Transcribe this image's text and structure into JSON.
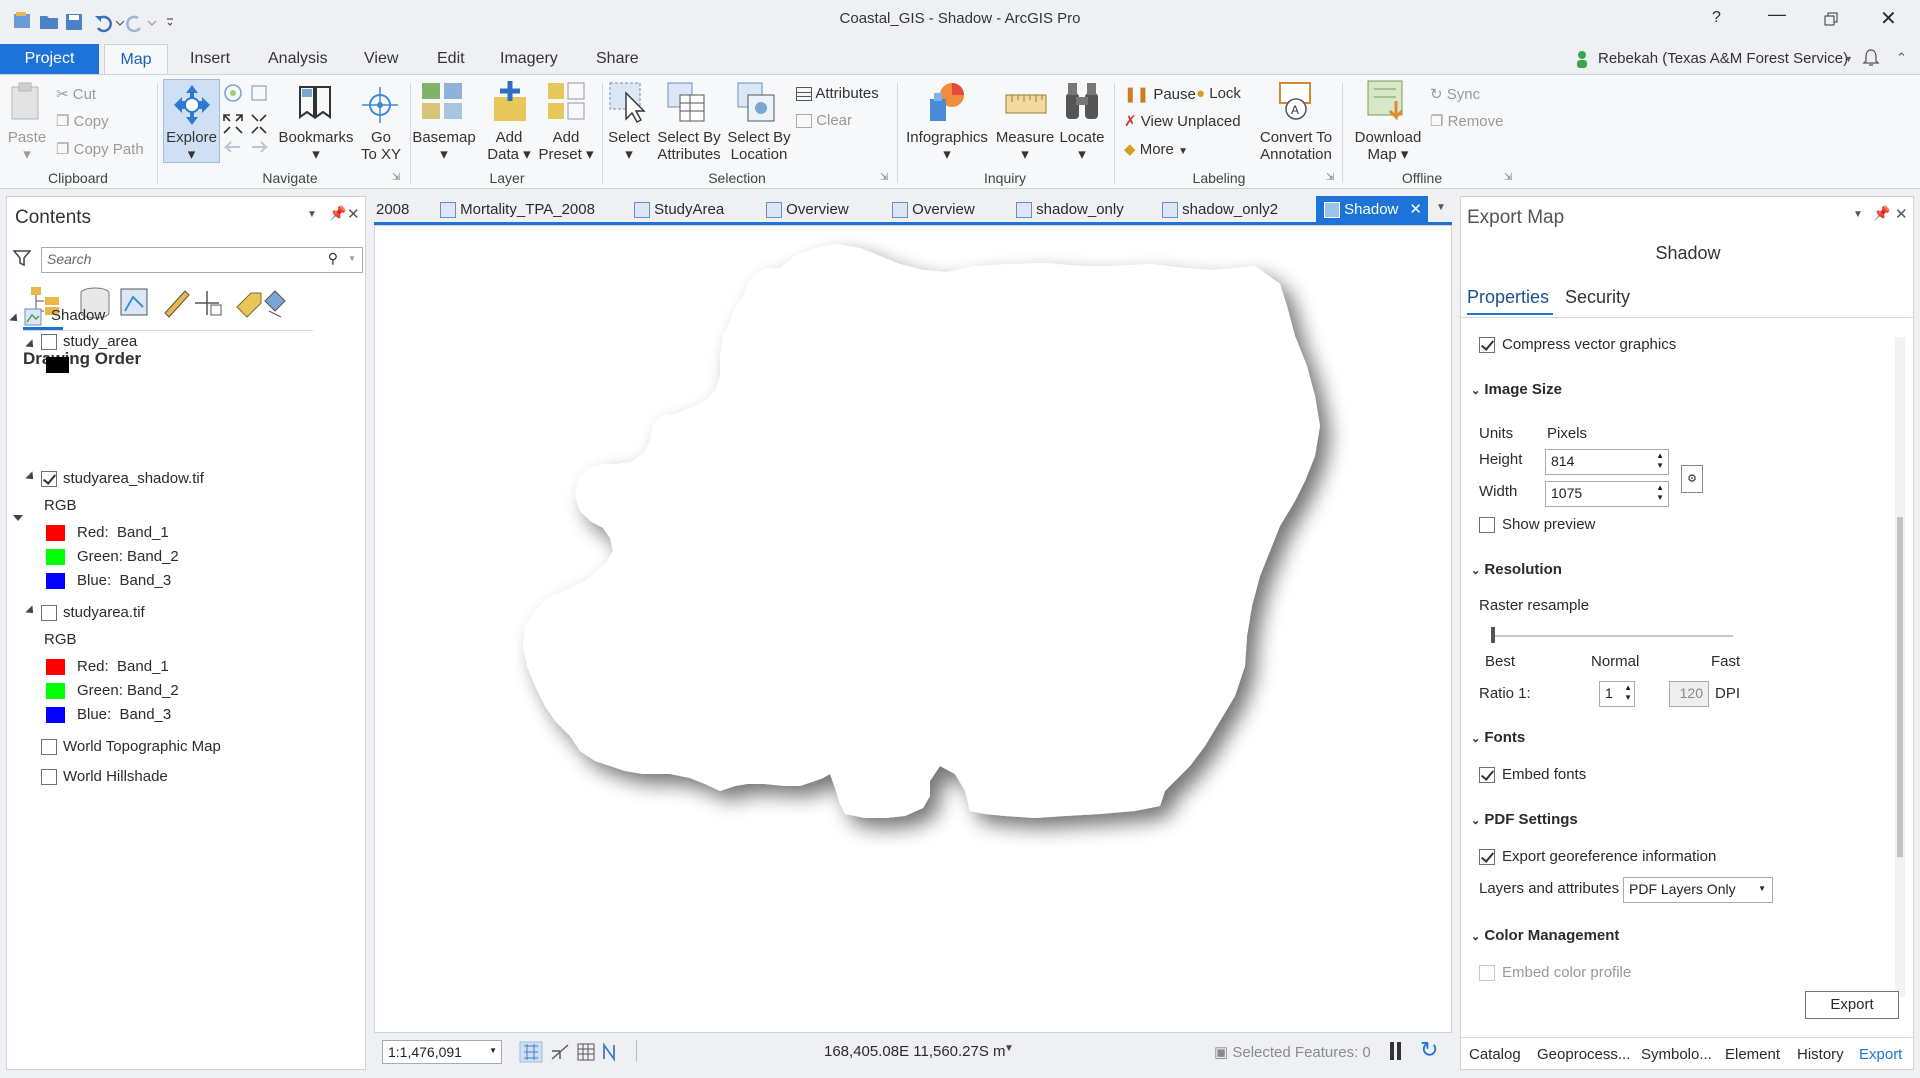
{
  "window": {
    "title": "Coastal_GIS - Shadow - ArcGIS Pro",
    "help": "?",
    "user": "Rebekah (Texas A&M Forest Service)"
  },
  "ribbon_tabs": [
    "Project",
    "Map",
    "Insert",
    "Analysis",
    "View",
    "Edit",
    "Imagery",
    "Share"
  ],
  "clipboard": {
    "paste": "Paste",
    "cut": "Cut",
    "copy": "Copy",
    "copy_path": "Copy Path",
    "label": "Clipboard"
  },
  "navigate": {
    "explore": "Explore",
    "bookmarks": "Bookmarks",
    "goto_1": "Go",
    "goto_2": "To XY",
    "label": "Navigate"
  },
  "layer": {
    "basemap": "Basemap",
    "add_data_1": "Add",
    "add_data_2": "Data",
    "add_preset_1": "Add",
    "add_preset_2": "Preset",
    "label": "Layer"
  },
  "selection": {
    "select": "Select",
    "by_attr_1": "Select By",
    "by_attr_2": "Attributes",
    "by_loc_1": "Select By",
    "by_loc_2": "Location",
    "attributes": "Attributes",
    "clear": "Clear",
    "label": "Selection"
  },
  "inquiry": {
    "infographics": "Infographics",
    "measure": "Measure",
    "locate": "Locate",
    "label": "Inquiry"
  },
  "labeling": {
    "pause": "Pause",
    "lock": "Lock",
    "view_unplaced": "View Unplaced",
    "more": "More",
    "convert_1": "Convert To",
    "convert_2": "Annotation",
    "label": "Labeling"
  },
  "offline": {
    "download_1": "Download",
    "download_2": "Map",
    "sync": "Sync",
    "remove": "Remove",
    "label": "Offline"
  },
  "contents": {
    "title": "Contents",
    "search_placeholder": "Search",
    "drawing_order": "Drawing Order",
    "map_name": "Shadow",
    "layers": [
      {
        "name": "study_area",
        "checked": false
      },
      {
        "name": "studyarea_shadow.tif",
        "checked": true,
        "rgb": "RGB",
        "bands": [
          "Red:  Band_1",
          "Green: Band_2",
          "Blue:  Band_3"
        ]
      },
      {
        "name": "studyarea.tif",
        "checked": false,
        "rgb": "RGB",
        "bands": [
          "Red:  Band_1",
          "Green: Band_2",
          "Blue:  Band_3"
        ]
      },
      {
        "name": "World Topographic Map",
        "checked": false
      },
      {
        "name": "World Hillshade",
        "checked": false
      }
    ]
  },
  "map_tabs": [
    "2008",
    "Mortality_TPA_2008",
    "StudyArea",
    "Overview",
    "Overview",
    "shadow_only",
    "shadow_only2",
    "Shadow"
  ],
  "status": {
    "scale": "1:1,476,091",
    "coords": "168,405.08E 11,560.27S m",
    "selected": "Selected Features: 0"
  },
  "export": {
    "title": "Export Map",
    "map_name": "Shadow",
    "tabs": [
      "Properties",
      "Security"
    ],
    "compress": "Compress vector graphics",
    "image_size": "Image Size",
    "units_label": "Units",
    "units_value": "Pixels",
    "height_label": "Height",
    "height_value": "814",
    "width_label": "Width",
    "width_value": "1075",
    "show_preview": "Show preview",
    "resolution": "Resolution",
    "raster_resample": "Raster resample",
    "slider": [
      "Best",
      "Normal",
      "Fast"
    ],
    "ratio_label": "Ratio 1:",
    "ratio_value": "1",
    "dpi_value": "120",
    "dpi_label": "DPI",
    "fonts": "Fonts",
    "embed_fonts": "Embed fonts",
    "pdf_settings": "PDF Settings",
    "georef": "Export georeference information",
    "layers_attr_label": "Layers and attributes",
    "layers_attr_value": "PDF Layers Only",
    "color_mgmt": "Color Management",
    "embed_color": "Embed color profile",
    "export_button": "Export"
  },
  "bottom_tabs": [
    "Catalog",
    "Geoprocess...",
    "Symbolo...",
    "Element",
    "History",
    "Export"
  ],
  "colors": {
    "accent": "#1e73d8",
    "red": "#ff0000",
    "green": "#00ff00",
    "blue": "#0000ff"
  }
}
